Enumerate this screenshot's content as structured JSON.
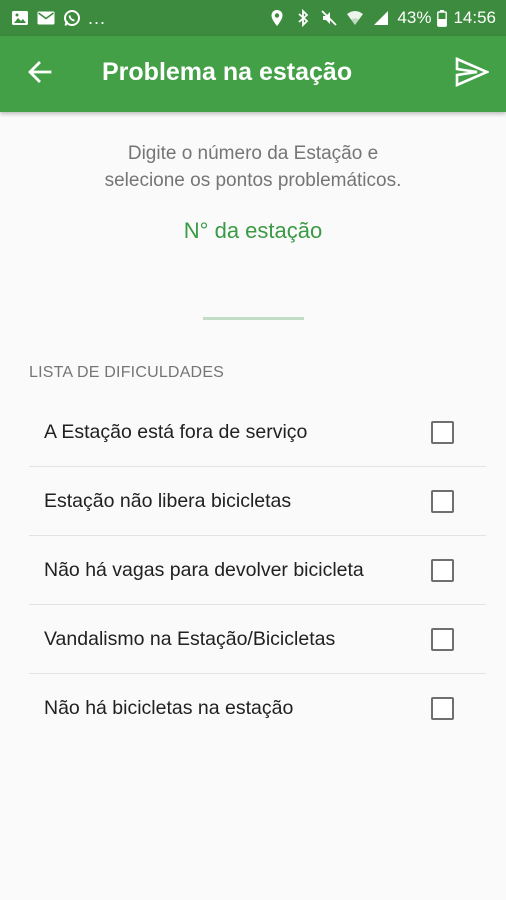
{
  "status_bar": {
    "left_icons": [
      "image-icon",
      "mail-icon",
      "whatsapp-icon"
    ],
    "more_notifications": "...",
    "right_icons": [
      "location-icon",
      "bluetooth-icon",
      "mute-icon",
      "wifi-icon",
      "signal-icon"
    ],
    "battery_percent": "43%",
    "time": "14:56"
  },
  "app_bar": {
    "title": "Problema na estação",
    "back_icon": "arrow-left-icon",
    "send_icon": "send-icon"
  },
  "instructions": {
    "line1": "Digite o número da Estação e",
    "line2": "selecione os pontos problemáticos."
  },
  "station_input": {
    "placeholder": "N° da estação",
    "value": ""
  },
  "difficulties": {
    "header": "LISTA DE DIFICULDADES",
    "items": [
      {
        "label": "A Estação está fora de serviço",
        "checked": false
      },
      {
        "label": "Estação não libera bicicletas",
        "checked": false
      },
      {
        "label": "Não há vagas para devolver bicicleta",
        "checked": false
      },
      {
        "label": "Vandalismo na Estação/Bicicletas",
        "checked": false
      },
      {
        "label": "Não há bicicletas na estação",
        "checked": false
      }
    ]
  },
  "colors": {
    "status_bar": "#3c8b3e",
    "app_bar": "#43a047",
    "accent": "#2e8b3a"
  }
}
